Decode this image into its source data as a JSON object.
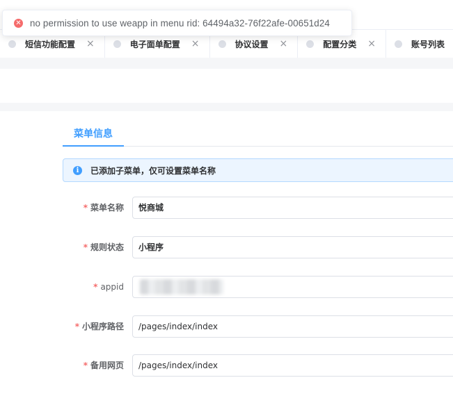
{
  "toast": {
    "type": "error",
    "icon": "close-circle-icon",
    "message": "no permission to use weapp in menu rid: 64494a32-76f22afe-00651d24"
  },
  "tabs": [
    {
      "label": "短信功能配置",
      "close": "×"
    },
    {
      "label": "电子面单配置",
      "close": "×"
    },
    {
      "label": "协议设置",
      "close": "×"
    },
    {
      "label": "配置分类",
      "close": "×"
    },
    {
      "label": "账号列表",
      "close": ""
    }
  ],
  "section": {
    "tab_label": "菜单信息"
  },
  "alert": {
    "icon": "info-circle-icon",
    "text": "已添加子菜单，仅可设置菜单名称"
  },
  "form": {
    "required_mark": "*",
    "fields": [
      {
        "label": "菜单名称",
        "value": "悦商城"
      },
      {
        "label": "规则状态",
        "value": "小程序"
      },
      {
        "label": "appid",
        "value": ""
      },
      {
        "label": "小程序路径",
        "value": "/pages/index/index"
      },
      {
        "label": "备用网页",
        "value": "/pages/index/index"
      }
    ]
  },
  "colors": {
    "primary": "#409eff",
    "danger": "#f56c6c",
    "info_bg": "#ecf5ff"
  }
}
